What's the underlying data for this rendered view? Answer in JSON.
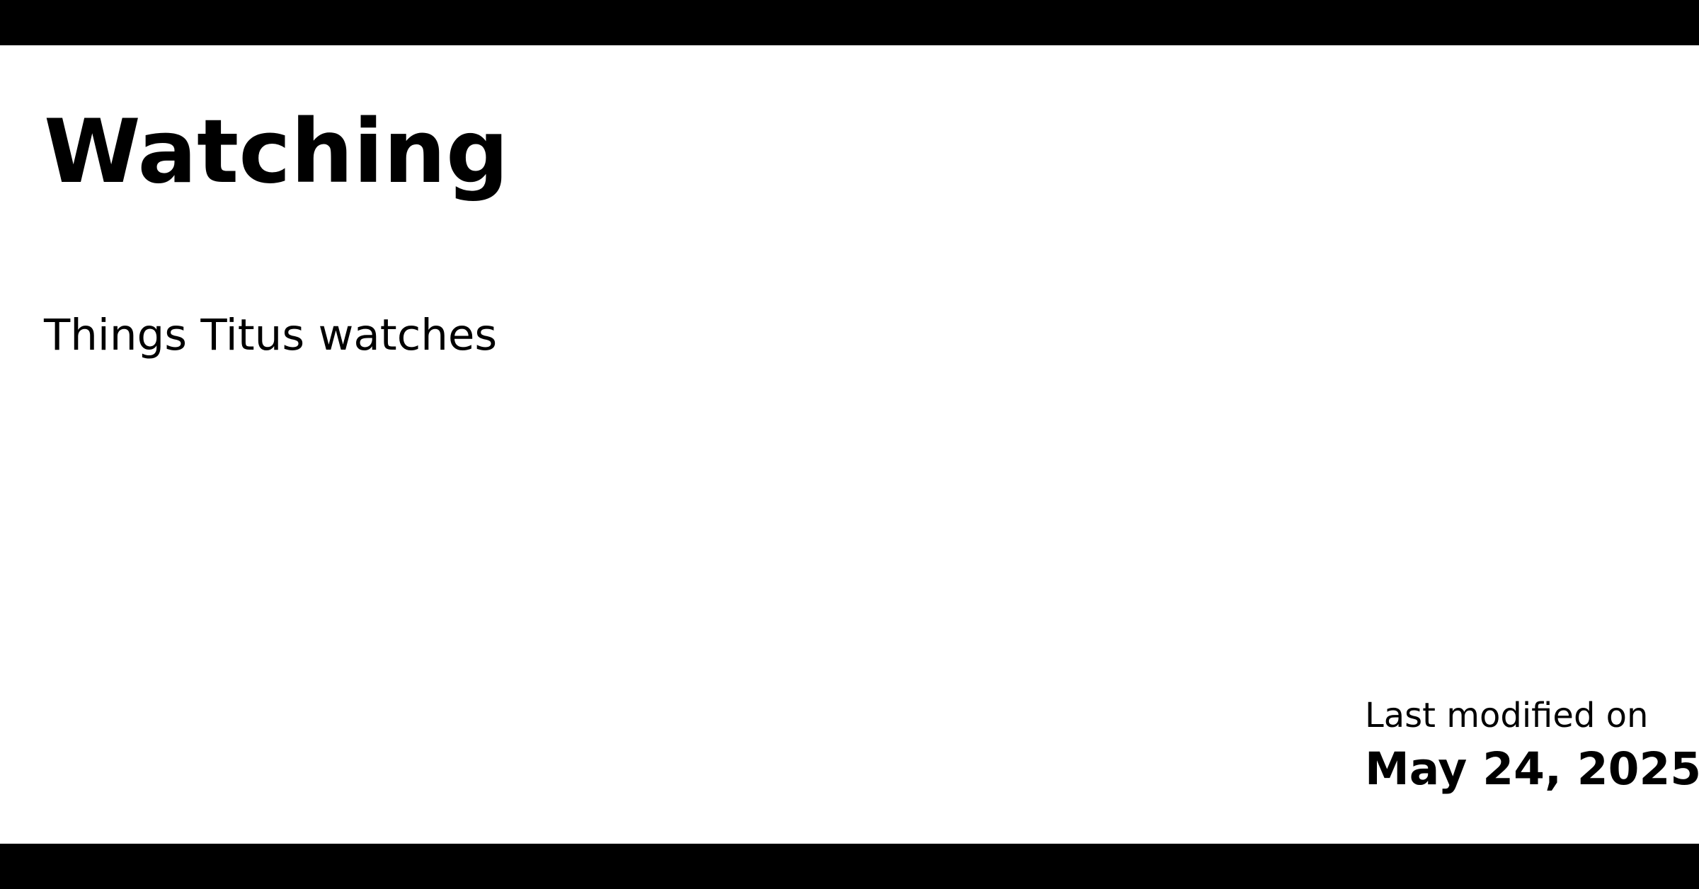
{
  "page": {
    "title": "Watching",
    "subtitle": "Things Titus watches",
    "last_modified_label": "Last modified on",
    "last_modified_date": "May 24, 2025"
  },
  "colors": {
    "background": "#ffffff",
    "text": "#000000",
    "bars": "#000000"
  }
}
